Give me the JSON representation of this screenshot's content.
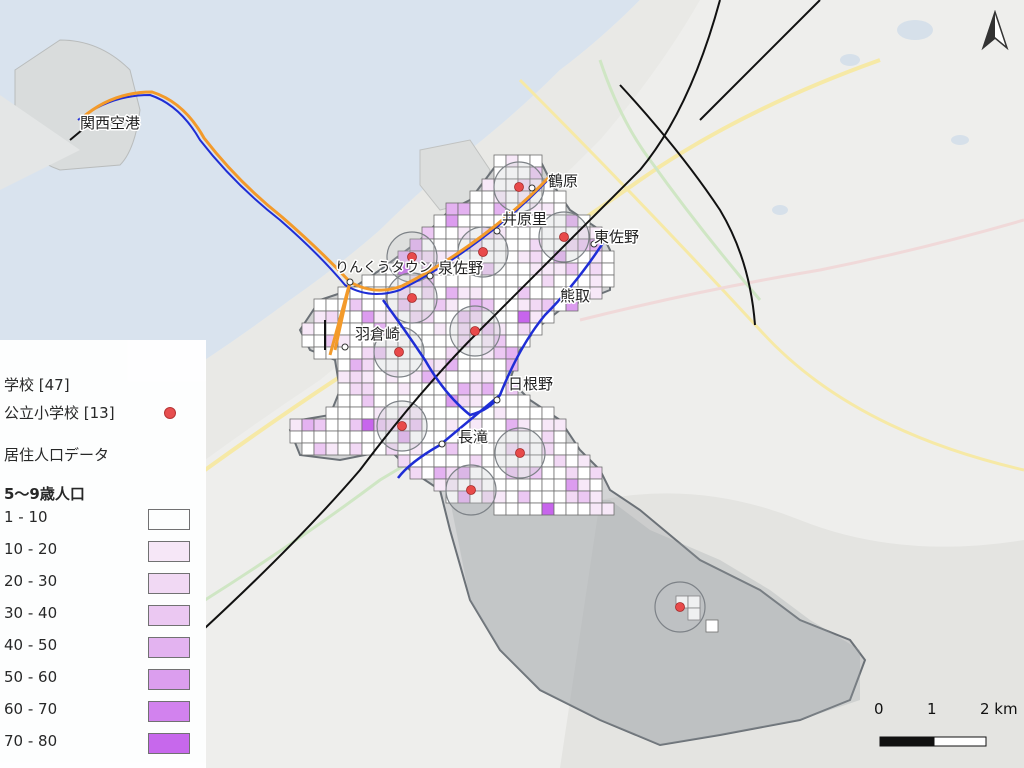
{
  "labels": {
    "kansai_airport": "関西空港",
    "rinku_town": "りんくうタウン",
    "izumisano": "泉佐野",
    "ihara_sato": "井原里",
    "tsuruhara": "鶴原",
    "higashi_sano": "東佐野",
    "kumatori": "熊取",
    "hagurazaki": "羽倉崎",
    "hineno": "日根野",
    "nagataki": "長滝"
  },
  "legend": {
    "school_layer": "学校 [47]",
    "school_item": "公立小学校 [13]",
    "population_layer": "居住人口データ",
    "population_field": "5〜9歳人口",
    "classes": [
      {
        "label": "1 - 10",
        "color": "#ffffff"
      },
      {
        "label": "10 - 20",
        "color": "#f7e8f8"
      },
      {
        "label": "20 - 30",
        "color": "#f2d9f5"
      },
      {
        "label": "30 - 40",
        "color": "#ecc8f3"
      },
      {
        "label": "40 - 50",
        "color": "#e4b2f1"
      },
      {
        "label": "50 - 60",
        "color": "#dc9cef"
      },
      {
        "label": "60 - 70",
        "color": "#d27fee"
      },
      {
        "label": "70 - 80",
        "color": "#c765ec"
      }
    ]
  },
  "scale": {
    "ticks": [
      "0",
      "1",
      "2 km"
    ]
  },
  "colors": {
    "school_point": "#e84a4a",
    "jr_line": "#1f2ed6",
    "airport_line": "#f39a2a",
    "rail_line": "#111111",
    "city_area": "#8f959b"
  },
  "icons": {
    "north_arrow": "north-arrow-icon",
    "school": "school-dot-icon"
  }
}
